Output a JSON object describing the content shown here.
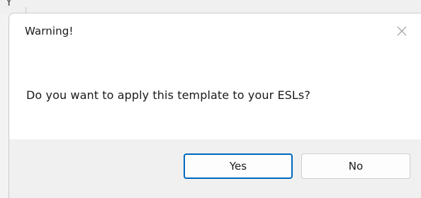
{
  "background": {
    "partial_text": "Y"
  },
  "dialog": {
    "title": "Warning!",
    "message": "Do you want to apply this template to your ESLs?",
    "buttons": {
      "yes_label": "Yes",
      "no_label": "No"
    },
    "close_icon": "close-icon"
  },
  "colors": {
    "primary_button_border": "#0067c0",
    "footer_background": "#f0f0f0",
    "dialog_background": "#ffffff"
  }
}
